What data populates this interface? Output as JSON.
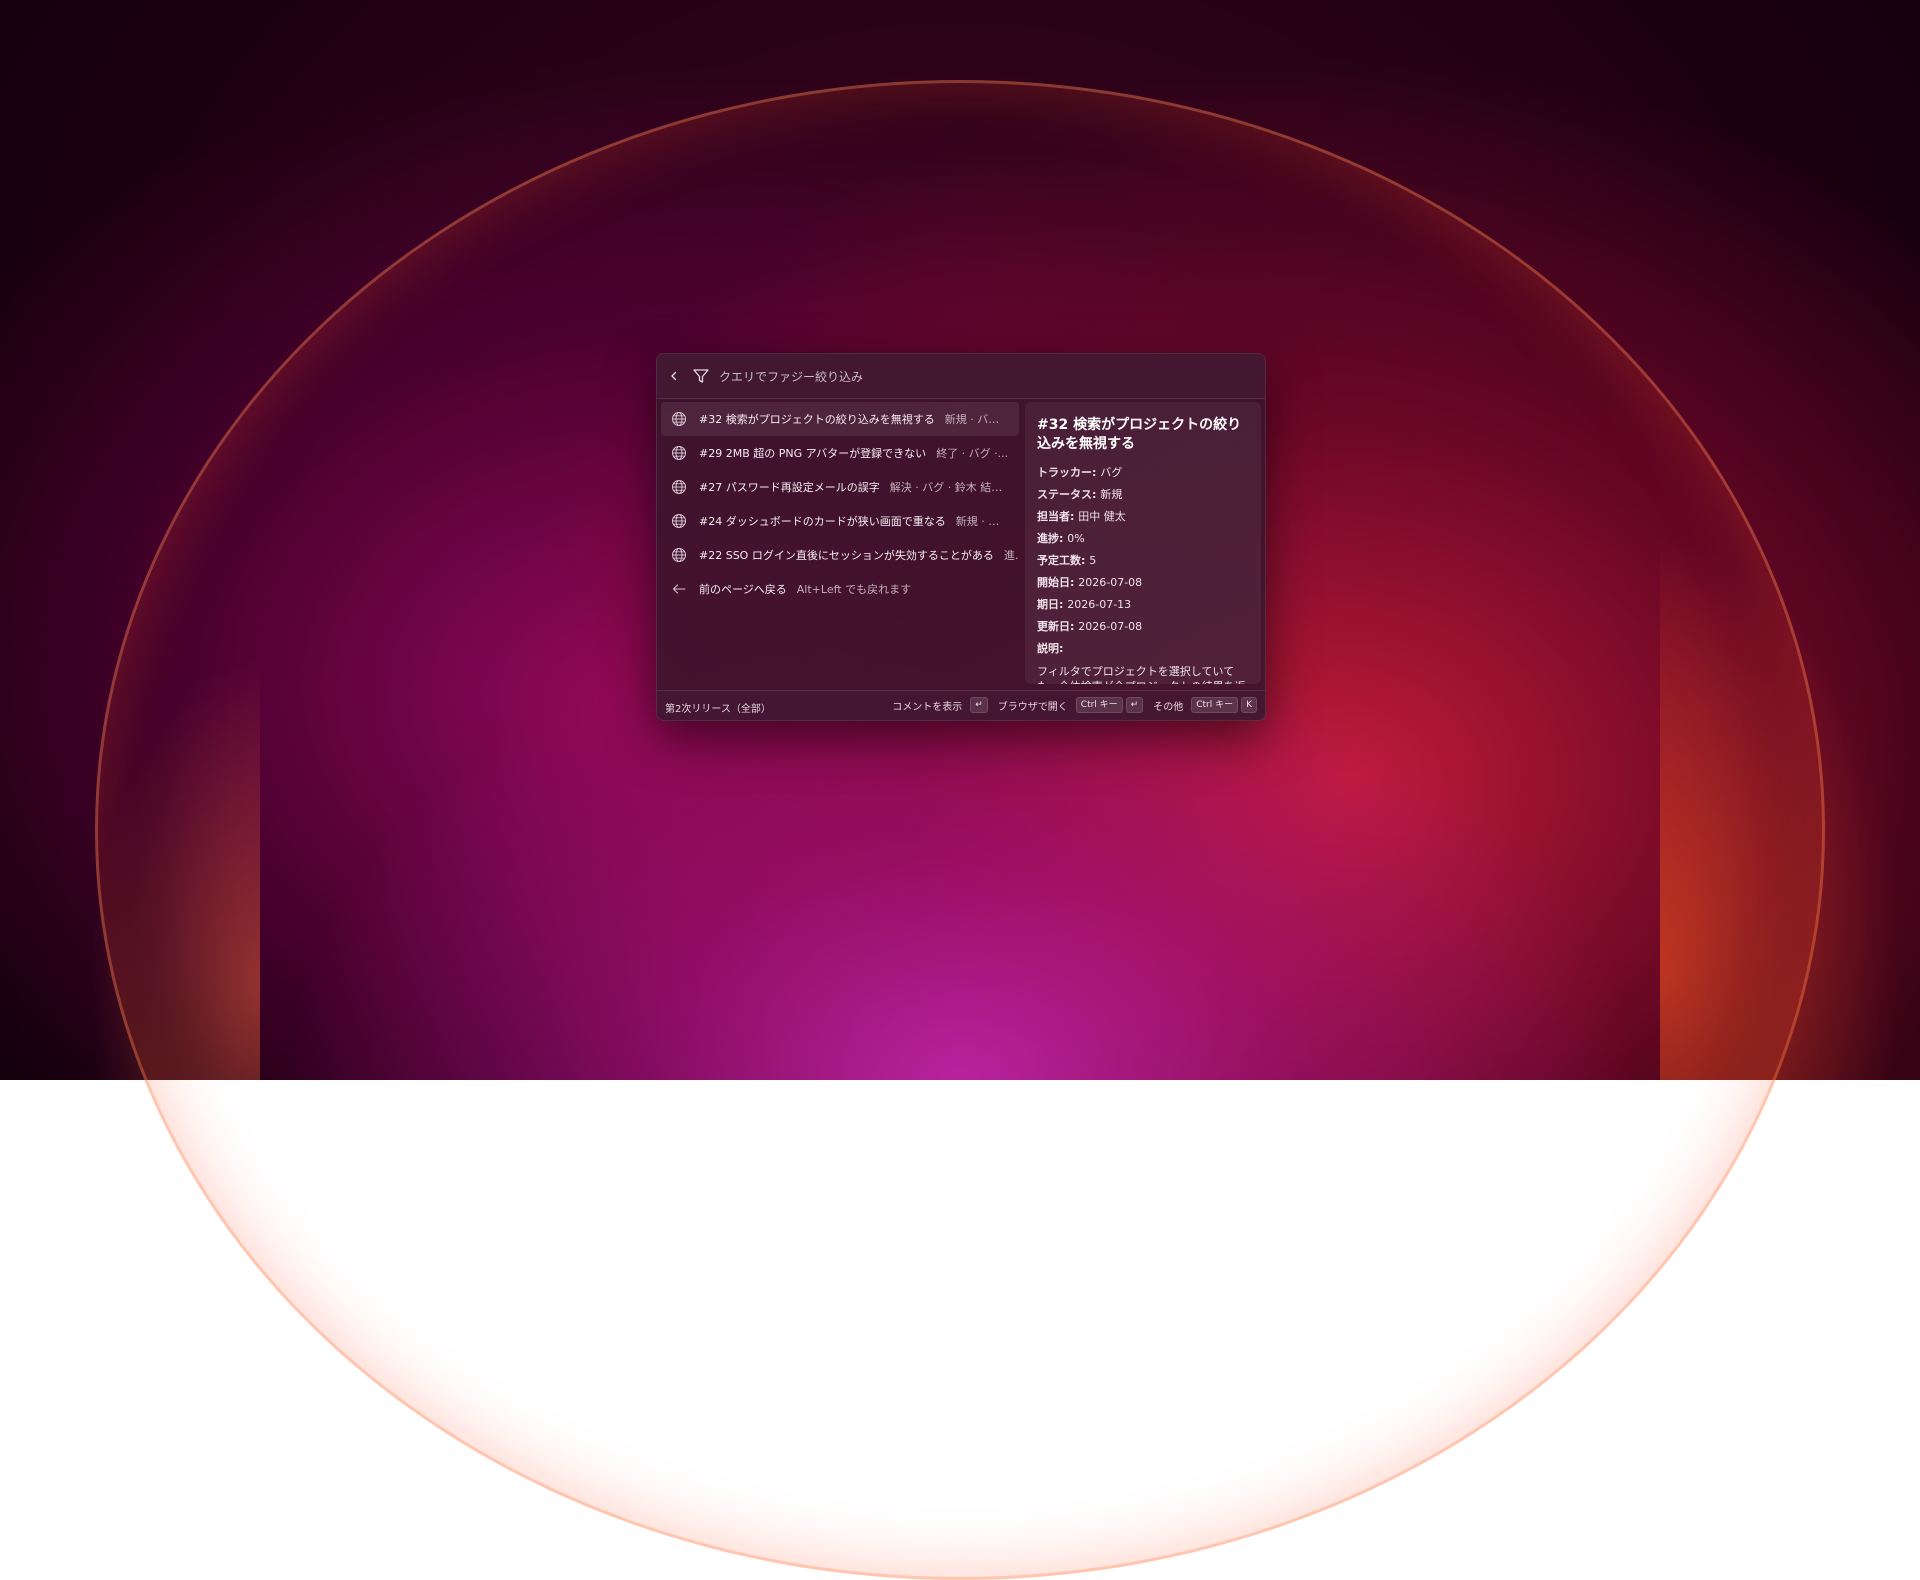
{
  "search": {
    "placeholder": "クエリでファジー絞り込み",
    "value": ""
  },
  "results": [
    {
      "title": "#32 検索がプロジェクトの絞り込みを無視する",
      "meta": "新規 · バグ ·...",
      "icon": "globe-icon",
      "selected": true
    },
    {
      "title": "#29 2MB 超の PNG アバターが登録できない",
      "meta": "終了 · バグ ·...",
      "icon": "globe-icon"
    },
    {
      "title": "#27 パスワード再設定メールの誤字",
      "meta": "解決 · バグ · 鈴木 結衣 ·...",
      "icon": "globe-icon"
    },
    {
      "title": "#24 ダッシュボードのカードが狭い画面で重なる",
      "meta": "新規 · バグ ·...",
      "icon": "globe-icon"
    },
    {
      "title": "#22 SSO ログイン直後にセッションが失効することがある",
      "meta": "進行...",
      "icon": "globe-icon"
    }
  ],
  "back_item": {
    "title": "前のページへ戻る",
    "meta": "Alt+Left でも戻れます",
    "icon": "arrow-left-icon"
  },
  "detail": {
    "title": "#32 検索がプロジェクトの絞り込みを無視する",
    "fields": [
      {
        "key": "トラッカー",
        "value": "バグ"
      },
      {
        "key": "ステータス",
        "value": "新規"
      },
      {
        "key": "担当者",
        "value": "田中 健太"
      },
      {
        "key": "進捗",
        "value": "0%"
      },
      {
        "key": "予定工数",
        "value": "5"
      },
      {
        "key": "開始日",
        "value": "2026-07-08"
      },
      {
        "key": "期日",
        "value": "2026-07-13"
      },
      {
        "key": "更新日",
        "value": "2026-07-08"
      }
    ],
    "description_label": "説明",
    "description": "フィルタでプロジェクトを選択していても、全体検索が全プロジェクトの結果を返します。"
  },
  "footer": {
    "context": "第2次リリース（全部）",
    "show_comments": "コメントを表示",
    "show_comments_key": "↵",
    "open_browser": "ブラウザで開く",
    "open_browser_key1": "Ctrl キー",
    "open_browser_key2": "↵",
    "more": "その他",
    "more_key1": "Ctrl キー",
    "more_key2": "K"
  }
}
